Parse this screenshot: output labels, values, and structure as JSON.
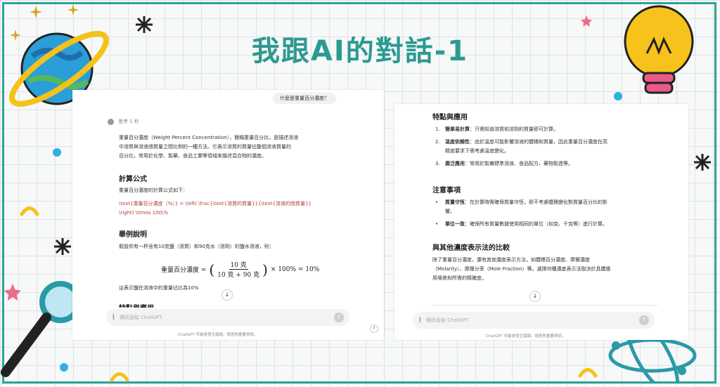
{
  "slide": {
    "title": "我跟AI的對話-1",
    "colors": {
      "accent": "#2c9a91",
      "frame": "#2fa39a"
    }
  },
  "left_panel": {
    "user_question": "什麼是重量百分濃度？",
    "thinking_label": "思考 1 秒",
    "intro": [
      "重量百分濃度（Weight Percent Concentration），簡稱重量百分比，是描述溶液",
      "中溶質與溶液總質量之間比例的一種方法。它表示溶質的質量佔整個溶液質量的",
      "百分比，常用於化學、製藥、食品工業等領域來描述混合物的濃度。"
    ],
    "h_formula": "計算公式",
    "formula_intro": "重量百分濃度的計算公式如下：",
    "latex": [
      "\\text{重量百分濃度（%）} = \\left( \\frac{\\text{溶質的質量}}{\\text{溶液的總質量}}",
      "\\right) \\times 100\\%"
    ],
    "h_example": "舉例說明",
    "example_text": "假設你有一杯含有10克鹽（溶質）和90克水（溶劑）的鹽水溶液，則：",
    "formula": {
      "lhs": "重量百分濃度 =",
      "numerator": "10 克",
      "denominator": "10 克 + 90 克",
      "rhs": "× 100% = 10%"
    },
    "result_text": "這表示鹽在溶液中的重量佔比為10%",
    "h_next_partial": "特點與應用",
    "input_placeholder": "傳訊息給 ChatGPT",
    "footnote": "ChatGPT 可能會發生錯誤。請查核重要資訊。"
  },
  "right_panel": {
    "h_features": "特點與應用",
    "features": [
      {
        "n": "1.",
        "bold": "簡單易計算",
        "text": "：只需知道溶質和溶劑的質量即可計算。"
      },
      {
        "n": "2.",
        "bold": "溫度依賴性",
        "text": "：由於溫度可能影響溶液的體積和質量，因此重量百分濃度在高",
        "text2": "精度要求下需考慮溫度變化。"
      },
      {
        "n": "3.",
        "bold": "廣泛應用",
        "text": "：常用於製備標準溶液、食品配方、藥物製造等。"
      }
    ],
    "h_notes": "注意事項",
    "notes": [
      {
        "bold": "質量守恆",
        "text": "：在計算時需確保質量守恆，即不考慮體積變化對質量百分比的影",
        "text2": "響。"
      },
      {
        "bold": "單位一致",
        "text": "：確保所有質量數據使用相同的單位（如克、千克等）進行計算。"
      }
    ],
    "h_compare": "與其他濃度表示法的比較",
    "compare_text": [
      "除了重量百分濃度，還有其他濃度表示方法，如體積百分濃度、摩爾濃度",
      "（Molarity）、摩爾分率（Mole Fraction）等。選擇何種濃度表示法取決於具體應",
      "用場景和所需的精確度。"
    ],
    "input_placeholder": "傳訊息給 ChatGPT",
    "footnote": "ChatGPT 可能會發生錯誤。請查核重要資訊。"
  }
}
